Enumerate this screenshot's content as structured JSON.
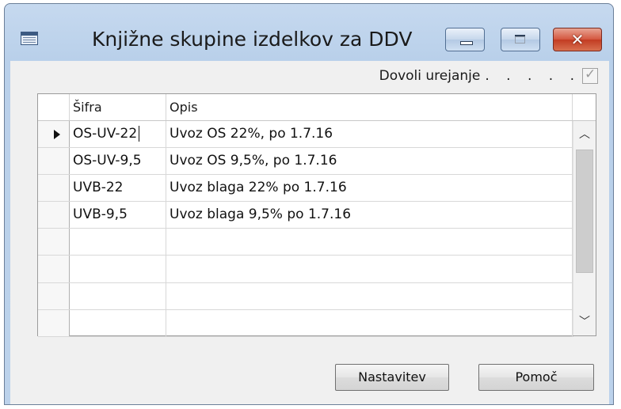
{
  "window": {
    "title": "Knjižne skupine izdelkov za DDV",
    "icon": "table-form-icon",
    "controls": [
      "minimize-icon",
      "maximize-icon",
      "close-icon"
    ],
    "close_glyph": "✕"
  },
  "toolbar": {
    "allow_edit_label": "Dovoli urejanje",
    "allow_edit_dots": ". . . . .",
    "allow_edit_checked": true
  },
  "grid": {
    "columns": [
      "Šifra",
      "Opis"
    ],
    "rows": [
      {
        "code": "OS-UV-22",
        "description": "Uvoz OS 22%, po 1.7.16"
      },
      {
        "code": "OS-UV-9,5",
        "description": "Uvoz OS 9,5%, po 1.7.16"
      },
      {
        "code": "UVB-22",
        "description": "Uvoz blaga 22% po 1.7.16"
      },
      {
        "code": "UVB-9,5",
        "description": "Uvoz blaga 9,5% po 1.7.16"
      },
      {
        "code": "",
        "description": ""
      },
      {
        "code": "",
        "description": ""
      },
      {
        "code": "",
        "description": ""
      },
      {
        "code": "",
        "description": ""
      }
    ],
    "scroll_up_glyph": "︿",
    "scroll_down_glyph": "﹀"
  },
  "buttons": {
    "setup_label": "Nastavitev",
    "help_label": "Pomoč"
  }
}
